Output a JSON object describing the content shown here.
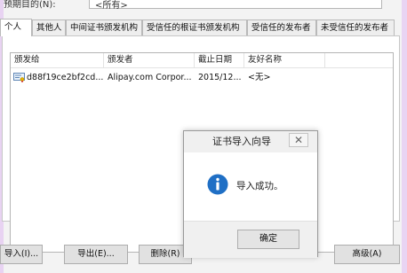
{
  "purpose": {
    "label": "预期目的(N):",
    "value": "<所有>"
  },
  "tabs": [
    {
      "label": "个人"
    },
    {
      "label": "其他人"
    },
    {
      "label": "中间证书颁发机构"
    },
    {
      "label": "受信任的根证书颁发机构"
    },
    {
      "label": "受信任的发布者"
    },
    {
      "label": "未受信任的发布者"
    }
  ],
  "columns": [
    {
      "label": "颁发给"
    },
    {
      "label": "颁发者"
    },
    {
      "label": "截止日期"
    },
    {
      "label": "友好名称"
    }
  ],
  "rows": [
    {
      "issued_to": "d88f19ce2bf2cd...",
      "issuer": "Alipay.com Corpor...",
      "expiry": "2015/12...",
      "friendly_name": "<无>"
    }
  ],
  "buttons": {
    "import": "导入(I)...",
    "export": "导出(E)...",
    "remove": "删除(R)",
    "advanced": "高级(A)"
  },
  "dialog": {
    "title": "证书导入向导",
    "message": "导入成功。",
    "ok": "确定",
    "close_glyph": "✕",
    "icon": "info-icon"
  },
  "colors": {
    "info_blue": "#1f6fc5",
    "frame_purple": "#e8d3f2"
  }
}
